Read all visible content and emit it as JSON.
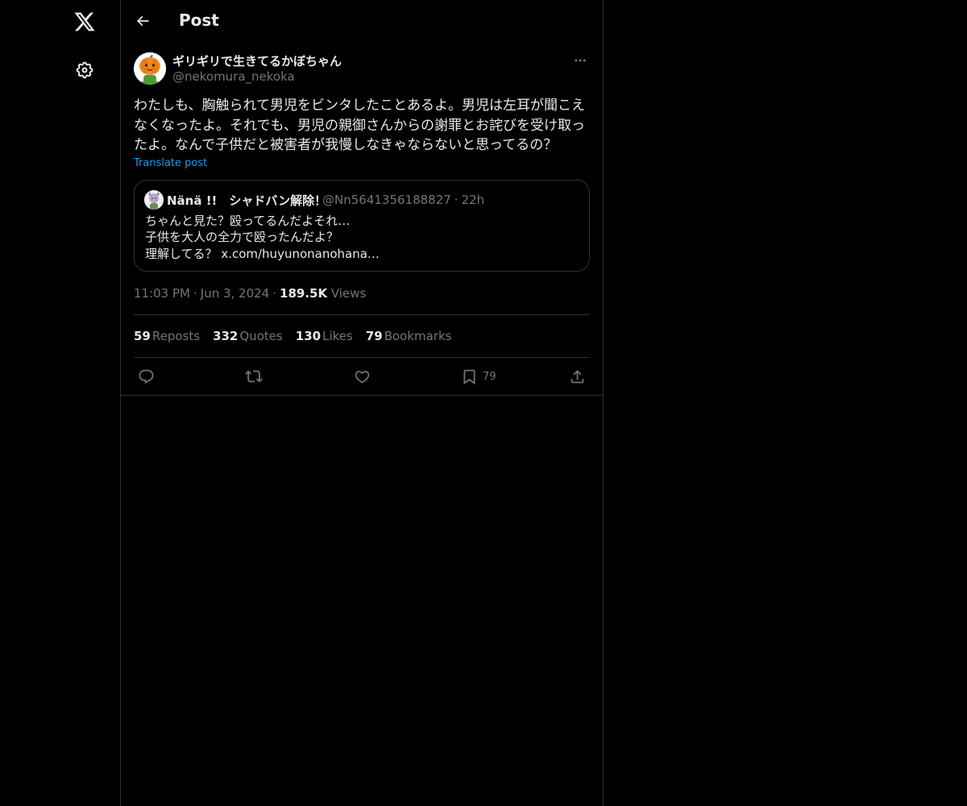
{
  "header": {
    "title": "Post"
  },
  "post": {
    "display_name": "ギリギリで生きてるかぼちゃん",
    "handle": "@nekomura_nekoka",
    "text": "わたしも、胸触られて男児をビンタしたことあるよ。男児は左耳が聞こえなくなったよ。それでも、男児の親御さんからの謝罪とお詫びを受け取ったよ。なんで子供だと被害者が我慢しなきゃならないと思ってるの？",
    "translate_label": "Translate post",
    "quote": {
      "display_name": "Nänä !!　シャドバン解除！",
      "handle": "@Nn5641356188827",
      "time": "22h",
      "text": "ちゃんと見た？殴ってるんだよそれ…\n子供を大人の全力で殴ったんだよ？\n理解してる？ x.com/huyunonanohana…"
    },
    "time": "11:03 PM",
    "date": "Jun 3, 2024",
    "views_count": "189.5K",
    "views_label": "Views",
    "stats": {
      "reposts": {
        "count": "59",
        "label": "Reposts"
      },
      "quotes": {
        "count": "332",
        "label": "Quotes"
      },
      "likes": {
        "count": "130",
        "label": "Likes"
      },
      "bookmarks": {
        "count": "79",
        "label": "Bookmarks"
      }
    },
    "actions": {
      "bookmark_count": "79"
    }
  },
  "icons": {
    "nav": [
      "x-logo-icon",
      "settings-gear-icon"
    ],
    "header": [
      "back-arrow-icon"
    ],
    "post": [
      "more-dots-icon"
    ],
    "actions": [
      "reply-icon",
      "repost-icon",
      "like-icon",
      "bookmark-icon",
      "share-icon"
    ]
  },
  "colors": {
    "background": "#000000",
    "text_primary": "#e7e9ea",
    "text_secondary": "#71767b",
    "link": "#1d9bf0",
    "border": "#2f3336"
  }
}
